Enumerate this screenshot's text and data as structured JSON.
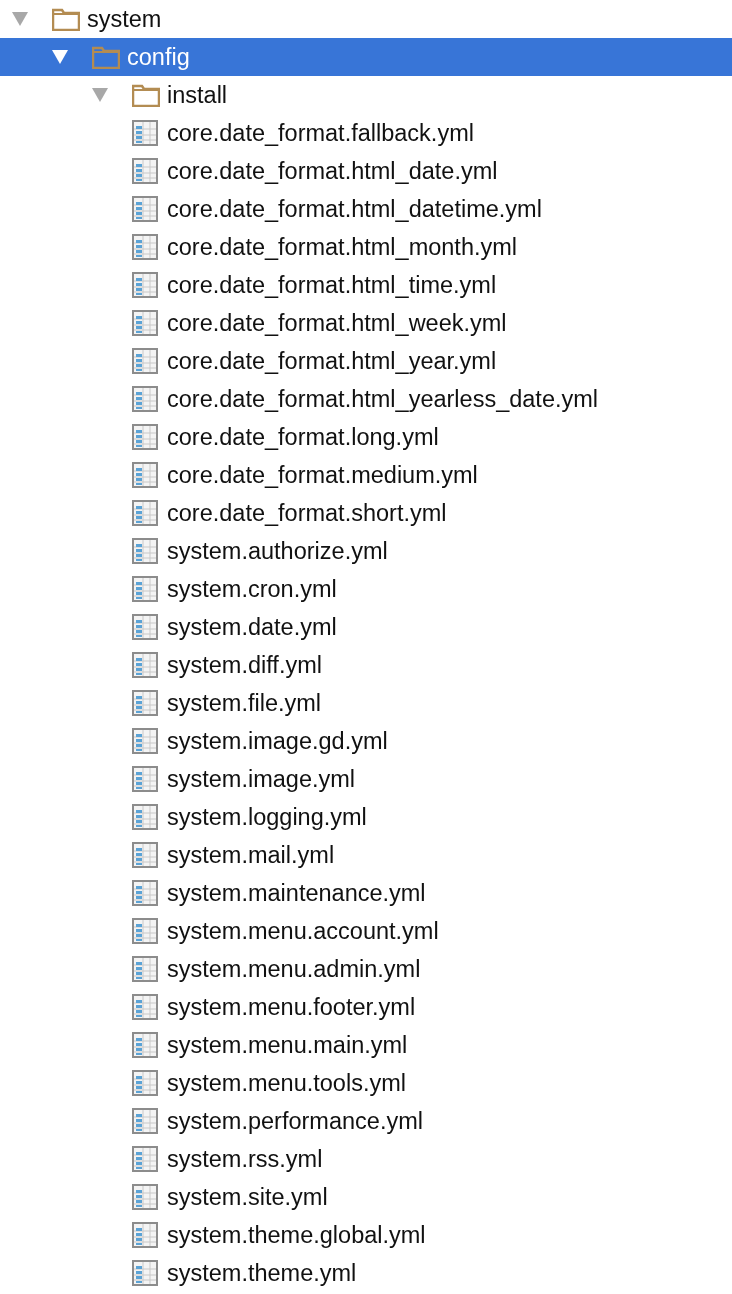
{
  "tree": [
    {
      "name": "system",
      "kind": "folder",
      "expanded": true,
      "selected": false,
      "children": [
        {
          "name": "config",
          "kind": "folder",
          "expanded": true,
          "selected": true,
          "children": [
            {
              "name": "install",
              "kind": "folder",
              "expanded": true,
              "selected": false,
              "children": [
                {
                  "name": "core.date_format.fallback.yml",
                  "kind": "file",
                  "selected": false
                },
                {
                  "name": "core.date_format.html_date.yml",
                  "kind": "file",
                  "selected": false
                },
                {
                  "name": "core.date_format.html_datetime.yml",
                  "kind": "file",
                  "selected": false
                },
                {
                  "name": "core.date_format.html_month.yml",
                  "kind": "file",
                  "selected": false
                },
                {
                  "name": "core.date_format.html_time.yml",
                  "kind": "file",
                  "selected": false
                },
                {
                  "name": "core.date_format.html_week.yml",
                  "kind": "file",
                  "selected": false
                },
                {
                  "name": "core.date_format.html_year.yml",
                  "kind": "file",
                  "selected": false
                },
                {
                  "name": "core.date_format.html_yearless_date.yml",
                  "kind": "file",
                  "selected": false
                },
                {
                  "name": "core.date_format.long.yml",
                  "kind": "file",
                  "selected": false
                },
                {
                  "name": "core.date_format.medium.yml",
                  "kind": "file",
                  "selected": false
                },
                {
                  "name": "core.date_format.short.yml",
                  "kind": "file",
                  "selected": false
                },
                {
                  "name": "system.authorize.yml",
                  "kind": "file",
                  "selected": false
                },
                {
                  "name": "system.cron.yml",
                  "kind": "file",
                  "selected": false
                },
                {
                  "name": "system.date.yml",
                  "kind": "file",
                  "selected": false
                },
                {
                  "name": "system.diff.yml",
                  "kind": "file",
                  "selected": false
                },
                {
                  "name": "system.file.yml",
                  "kind": "file",
                  "selected": false
                },
                {
                  "name": "system.image.gd.yml",
                  "kind": "file",
                  "selected": false
                },
                {
                  "name": "system.image.yml",
                  "kind": "file",
                  "selected": false
                },
                {
                  "name": "system.logging.yml",
                  "kind": "file",
                  "selected": false
                },
                {
                  "name": "system.mail.yml",
                  "kind": "file",
                  "selected": false
                },
                {
                  "name": "system.maintenance.yml",
                  "kind": "file",
                  "selected": false
                },
                {
                  "name": "system.menu.account.yml",
                  "kind": "file",
                  "selected": false
                },
                {
                  "name": "system.menu.admin.yml",
                  "kind": "file",
                  "selected": false
                },
                {
                  "name": "system.menu.footer.yml",
                  "kind": "file",
                  "selected": false
                },
                {
                  "name": "system.menu.main.yml",
                  "kind": "file",
                  "selected": false
                },
                {
                  "name": "system.menu.tools.yml",
                  "kind": "file",
                  "selected": false
                },
                {
                  "name": "system.performance.yml",
                  "kind": "file",
                  "selected": false
                },
                {
                  "name": "system.rss.yml",
                  "kind": "file",
                  "selected": false
                },
                {
                  "name": "system.site.yml",
                  "kind": "file",
                  "selected": false
                },
                {
                  "name": "system.theme.global.yml",
                  "kind": "file",
                  "selected": false
                },
                {
                  "name": "system.theme.yml",
                  "kind": "file",
                  "selected": false
                }
              ]
            }
          ]
        }
      ]
    }
  ]
}
